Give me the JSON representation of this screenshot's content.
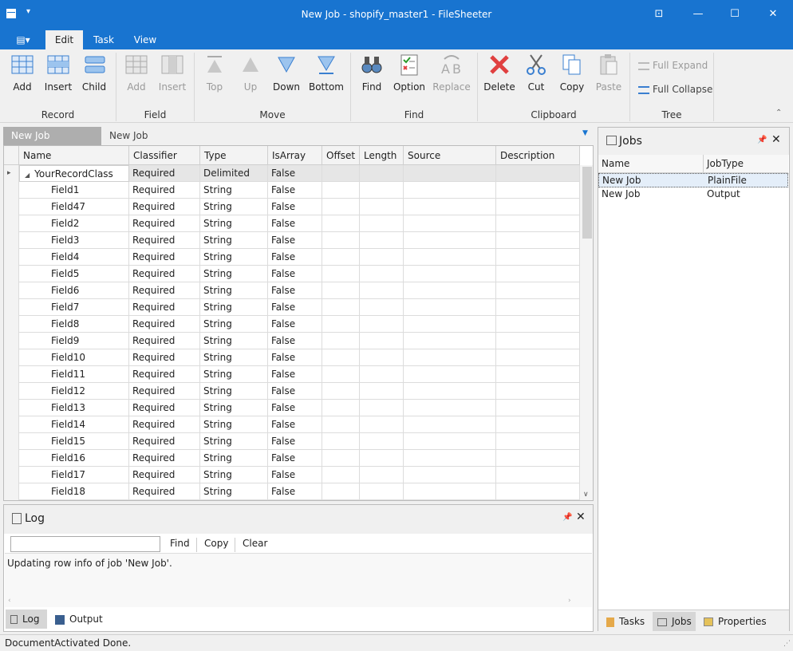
{
  "window": {
    "title": "New Job - shopify_master1 - FileSheeter"
  },
  "menu": {
    "tabs": [
      "Edit",
      "Task",
      "View"
    ],
    "active": "Edit"
  },
  "ribbon": {
    "groups": [
      "Record",
      "Field",
      "Move",
      "Find",
      "Clipboard",
      "Tree"
    ],
    "buttons": {
      "record_add": "Add",
      "record_insert": "Insert",
      "record_child": "Child",
      "field_add": "Add",
      "field_insert": "Insert",
      "move_top": "Top",
      "move_up": "Up",
      "move_down": "Down",
      "move_bottom": "Bottom",
      "find": "Find",
      "option": "Option",
      "replace": "Replace",
      "delete": "Delete",
      "cut": "Cut",
      "copy": "Copy",
      "paste": "Paste",
      "full_expand": "Full Expand",
      "full_collapse": "Full Collapse"
    }
  },
  "doc_tabs": [
    "New Job",
    "New Job"
  ],
  "grid": {
    "columns": [
      "Name",
      "Classifier",
      "Type",
      "IsArray",
      "Offset",
      "Length",
      "Source",
      "Description"
    ],
    "rows": [
      [
        "YourRecordClass",
        "Required",
        "Delimited",
        "False"
      ],
      [
        "Field1",
        "Required",
        "String",
        "False"
      ],
      [
        "Field47",
        "Required",
        "String",
        "False"
      ],
      [
        "Field2",
        "Required",
        "String",
        "False"
      ],
      [
        "Field3",
        "Required",
        "String",
        "False"
      ],
      [
        "Field4",
        "Required",
        "String",
        "False"
      ],
      [
        "Field5",
        "Required",
        "String",
        "False"
      ],
      [
        "Field6",
        "Required",
        "String",
        "False"
      ],
      [
        "Field7",
        "Required",
        "String",
        "False"
      ],
      [
        "Field8",
        "Required",
        "String",
        "False"
      ],
      [
        "Field9",
        "Required",
        "String",
        "False"
      ],
      [
        "Field10",
        "Required",
        "String",
        "False"
      ],
      [
        "Field11",
        "Required",
        "String",
        "False"
      ],
      [
        "Field12",
        "Required",
        "String",
        "False"
      ],
      [
        "Field13",
        "Required",
        "String",
        "False"
      ],
      [
        "Field14",
        "Required",
        "String",
        "False"
      ],
      [
        "Field15",
        "Required",
        "String",
        "False"
      ],
      [
        "Field16",
        "Required",
        "String",
        "False"
      ],
      [
        "Field17",
        "Required",
        "String",
        "False"
      ],
      [
        "Field18",
        "Required",
        "String",
        "False"
      ]
    ]
  },
  "log": {
    "title": "Log",
    "find_label": "Find",
    "copy_label": "Copy",
    "clear_label": "Clear",
    "message": "Updating row info of job 'New Job'.",
    "tabs": [
      "Log",
      "Output"
    ]
  },
  "jobs": {
    "title": "Jobs",
    "columns": [
      "Name",
      "JobType"
    ],
    "rows": [
      [
        "New Job",
        "PlainFile"
      ],
      [
        "New Job",
        "Output"
      ]
    ],
    "tabs": [
      "Tasks",
      "Jobs",
      "Properties"
    ]
  },
  "status": {
    "text": "DocumentActivated Done."
  },
  "colors": {
    "accent": "#1874d0",
    "delete_red": "#e04040",
    "icon_blue": "#3a7fd0"
  }
}
